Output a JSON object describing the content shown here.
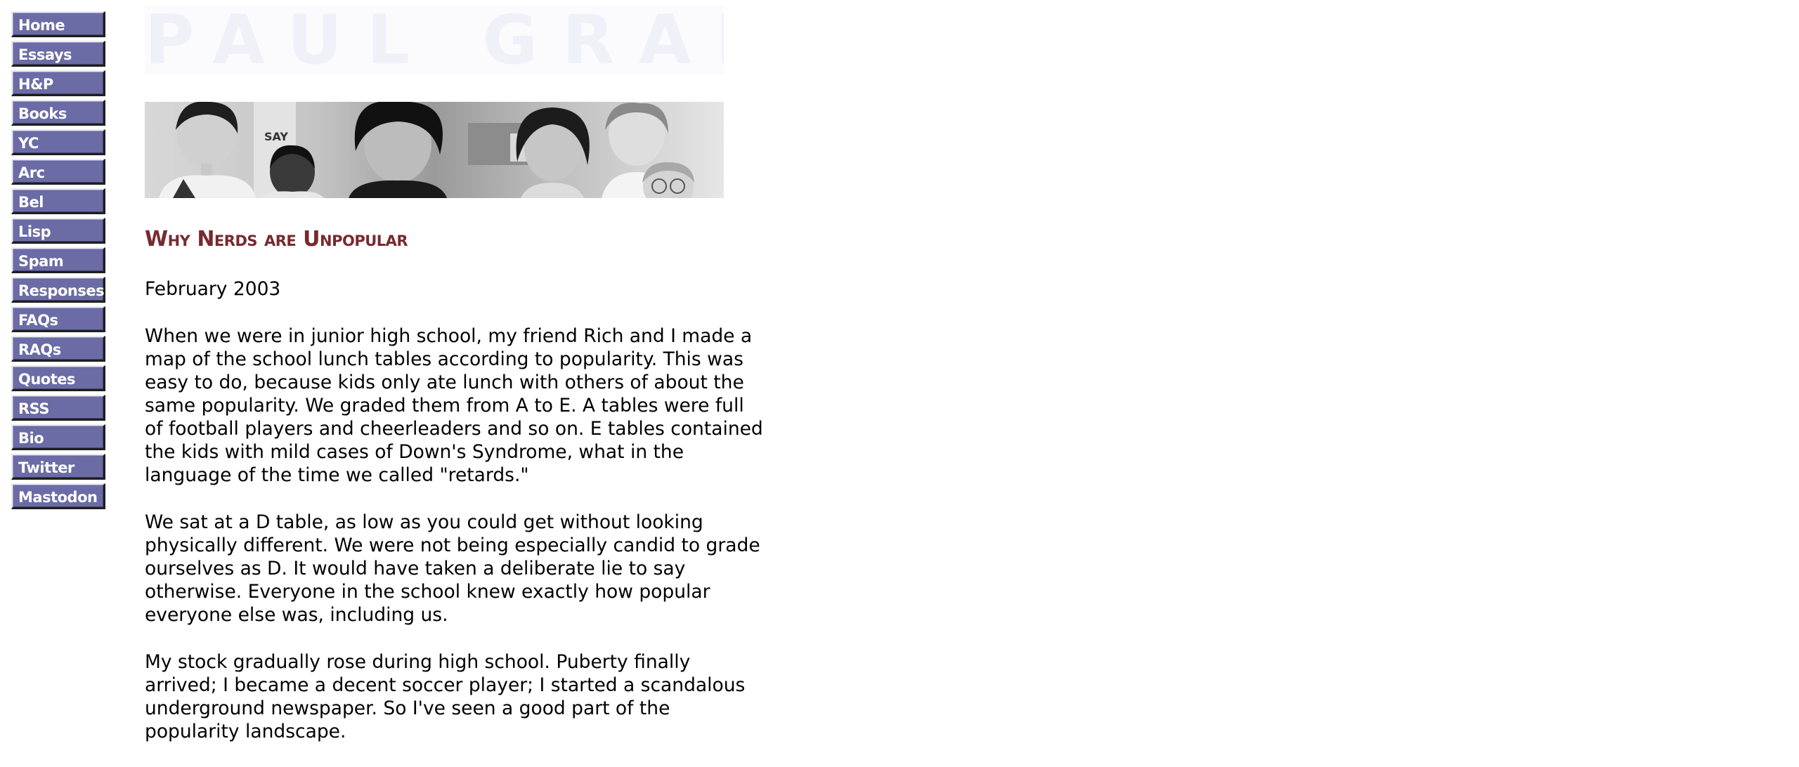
{
  "nav": {
    "items": [
      {
        "label": "Home"
      },
      {
        "label": "Essays"
      },
      {
        "label": "H&P"
      },
      {
        "label": "Books"
      },
      {
        "label": "YC"
      },
      {
        "label": "Arc"
      },
      {
        "label": "Bel"
      },
      {
        "label": "Lisp"
      },
      {
        "label": "Spam"
      },
      {
        "label": "Responses"
      },
      {
        "label": "FAQs"
      },
      {
        "label": "RAQs"
      },
      {
        "label": "Quotes"
      },
      {
        "label": "RSS"
      },
      {
        "label": "Bio"
      },
      {
        "label": "Twitter"
      },
      {
        "label": "Mastodon"
      }
    ]
  },
  "header": {
    "logo_text": "PAUL GRAHAM"
  },
  "photo": {
    "sign_text": "SAY"
  },
  "article": {
    "title": "Why Nerds are Unpopular",
    "date": "February 2003",
    "paragraphs": [
      "When we were in junior high school, my friend Rich and I made a map of the school lunch tables according to popularity. This was easy to do, because kids only ate lunch with others of about the same popularity. We graded them from A to E. A tables were full of football players and cheerleaders and so on. E tables contained the kids with mild cases of Down's Syndrome, what in the language of the time we called \"retards.\"",
      "We sat at a D table, as low as you could get without looking physically different. We were not being especially candid to grade ourselves as D. It would have taken a deliberate lie to say otherwise. Everyone in the school knew exactly how popular everyone else was, including us.",
      "My stock gradually rose during high school. Puberty finally arrived; I became a decent soccer player; I started a scandalous underground newspaper. So I've seen a good part of the popularity landscape."
    ]
  },
  "colors": {
    "nav_button": "#6b6ba6",
    "title": "#772a30",
    "logo_text": "#eff0f8",
    "body_text": "#000000"
  }
}
